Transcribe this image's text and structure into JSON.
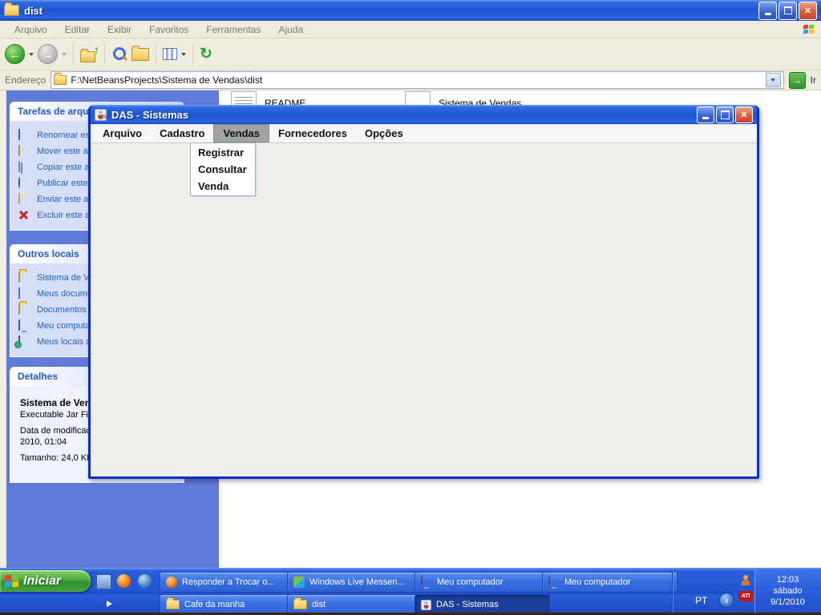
{
  "colors": {
    "titlebar_blue": "#1c55d4",
    "window_border_blue": "#0d2ec0",
    "taskbar_blue": "#2256d2",
    "start_green": "#47a33a",
    "sidebar_background": "#5f7ad8",
    "panel_body": "#d6dff7",
    "link_blue": "#215dc6",
    "das_body_gray": "#efefec",
    "selected_menu_gray": "#a3a3a3",
    "close_red": "#dd5f3d"
  },
  "icons": {
    "back_glyph": "←",
    "forward_glyph": "→",
    "up_glyph": "↑",
    "go_glyph": "→",
    "refresh_glyph": "↻",
    "close_glyph": "✕",
    "collapse_glyph": "‹",
    "dropdown_glyph": "▼"
  },
  "explorer": {
    "title": "dist",
    "menu_items": [
      "Arquivo",
      "Editar",
      "Exibir",
      "Favoritos",
      "Ferramentas",
      "Ajuda"
    ],
    "address": {
      "label": "Endereço",
      "value": "F:\\NetBeansProjects\\Sistema de Vendas\\dist",
      "go_label": "Ir"
    },
    "files": [
      {
        "name": "README"
      },
      {
        "name": "Sistema de Vendas"
      }
    ],
    "sidebar": {
      "tasks": {
        "title": "Tarefas de arqu",
        "items": [
          {
            "icon": "rename-icon",
            "label": "Renomear es"
          },
          {
            "icon": "move-icon",
            "label": "Mover este a"
          },
          {
            "icon": "copy-icon",
            "label": "Copiar este a"
          },
          {
            "icon": "publish-icon",
            "label": "Publicar este"
          },
          {
            "icon": "email-icon",
            "label": "Enviar este a"
          },
          {
            "icon": "delete-icon",
            "label": "Excluir este a"
          }
        ]
      },
      "places": {
        "title": "Outros locais",
        "items": [
          {
            "icon": "folder-icon",
            "label": "Sistema de V"
          },
          {
            "icon": "documents-icon",
            "label": "Meus docume"
          },
          {
            "icon": "folder-icon",
            "label": "Documentos"
          },
          {
            "icon": "computer-icon",
            "label": "Meu computa"
          },
          {
            "icon": "network-icon",
            "label": "Meus locais d"
          }
        ]
      },
      "details": {
        "title": "Detalhes",
        "file_name": "Sistema de Ven",
        "file_type": "Executable Jar Fil",
        "modified_label": "Data de modificaç",
        "modified_value": "2010, 01:04",
        "size": "Tamanho: 24,0 KB"
      }
    }
  },
  "das": {
    "title": "DAS - Sistemas",
    "menu_items": [
      "Arquivo",
      "Cadastro",
      "Vendas",
      "Fornecedores",
      "Opções"
    ],
    "selected_menu": "Vendas",
    "dropdown": {
      "items": [
        "Registrar",
        "Consultar",
        "Venda"
      ]
    }
  },
  "taskbar": {
    "start_label": "Iniciar",
    "row1": [
      {
        "icon": "firefox-icon",
        "label": "Responder a Trocar o..."
      },
      {
        "icon": "messenger-icon",
        "label": "Windows Live Messen..."
      },
      {
        "icon": "computer-icon",
        "label": "Meu computador"
      },
      {
        "icon": "computer-icon",
        "label": "Meu computador"
      }
    ],
    "row2": [
      {
        "icon": "folder-icon",
        "label": "Cafe da manha"
      },
      {
        "icon": "folder-icon",
        "label": "dist"
      },
      {
        "icon": "java-icon",
        "label": "DAS - Sistemas",
        "active": true
      }
    ],
    "tray": {
      "lang": "PT",
      "ati_label": "ATI",
      "time": "12:03",
      "day": "sábado",
      "date": "9/1/2010"
    }
  }
}
